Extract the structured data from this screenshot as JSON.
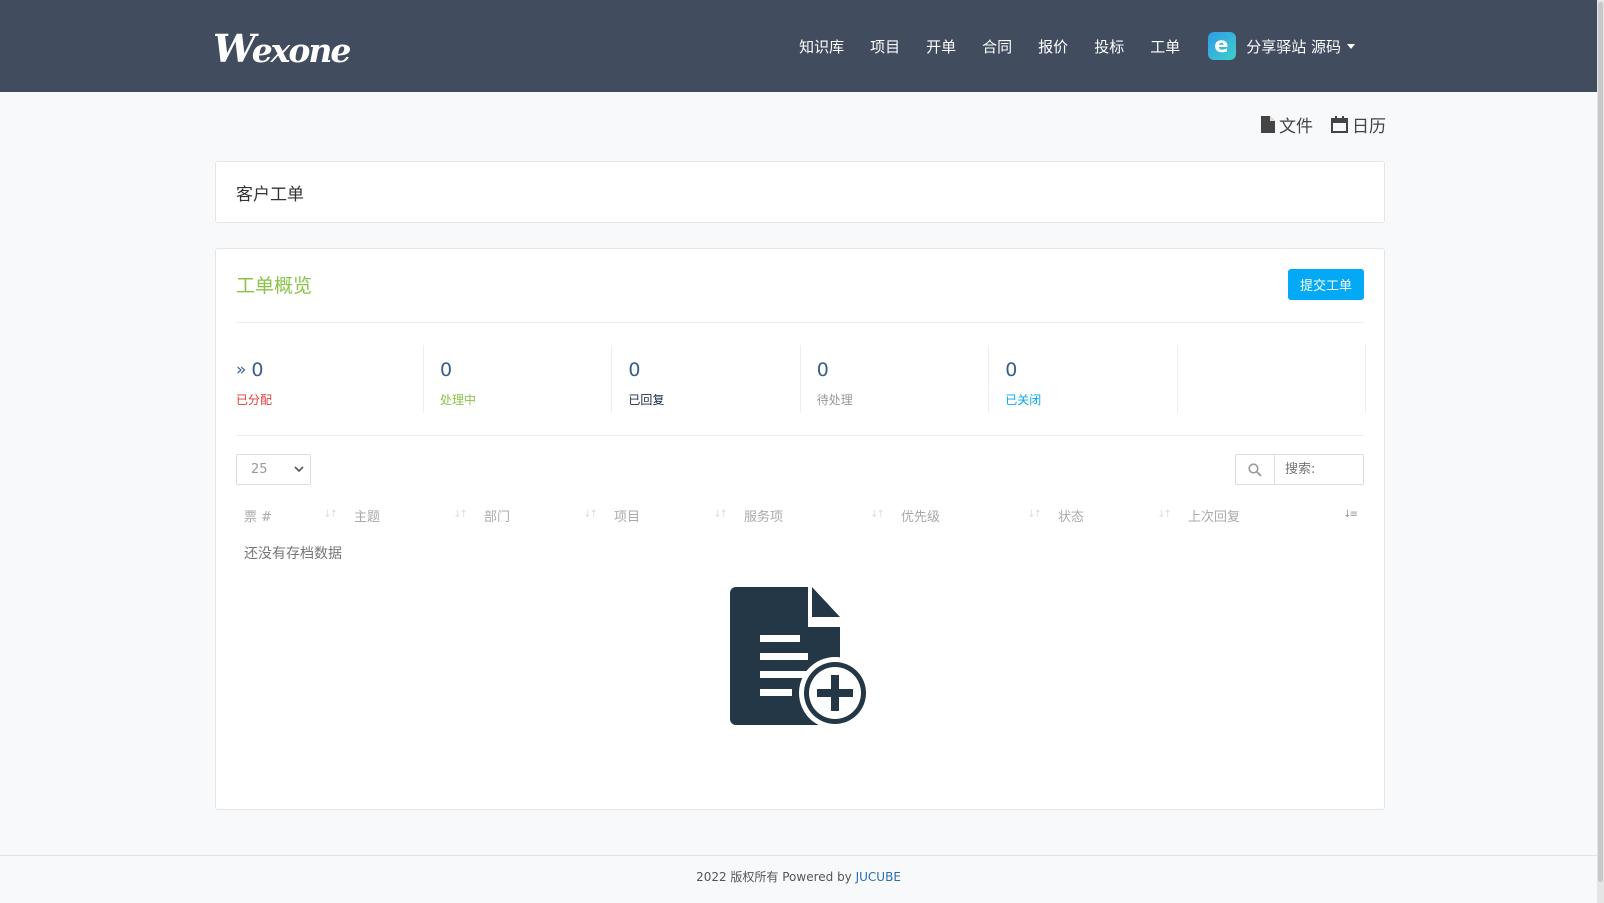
{
  "brand": {
    "logo_text": "Wexone"
  },
  "nav": {
    "items": [
      "知识库",
      "项目",
      "开单",
      "合同",
      "报价",
      "投标",
      "工单"
    ],
    "user_name": "分享驿站 源码",
    "avatar_letter": "e"
  },
  "top_links": {
    "files": "文件",
    "calendar": "日历"
  },
  "page_panel": {
    "title": "客户工单"
  },
  "overview": {
    "title": "工单概览",
    "submit_button": "提交工单",
    "stats": [
      {
        "value": "0",
        "label": "已分配",
        "color": "#e03a3a"
      },
      {
        "value": "0",
        "label": "处理中",
        "color": "#8bc34a"
      },
      {
        "value": "0",
        "label": "已回复",
        "color": "#1a2a4a"
      },
      {
        "value": "0",
        "label": "待处理",
        "color": "#999999"
      },
      {
        "value": "0",
        "label": "已关闭",
        "color": "#03a9f4"
      }
    ]
  },
  "table": {
    "page_length": "25",
    "search_placeholder": "搜索:",
    "columns": [
      "票 #",
      "主题",
      "部门",
      "项目",
      "服务项",
      "优先级",
      "状态",
      "上次回复"
    ],
    "empty_text": "还没有存档数据"
  },
  "footer": {
    "text": "2022 版权所有 Powered by ",
    "link": "JUCUBE"
  },
  "colors": {
    "navbar": "#414d5f",
    "accent": "#03a9f4",
    "overview_title": "#8bc34a"
  }
}
